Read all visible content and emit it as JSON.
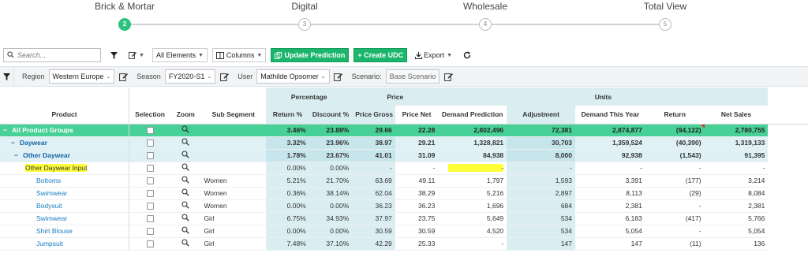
{
  "stepper": {
    "steps": [
      {
        "label": "Brick & Mortar",
        "number": "2",
        "active": true
      },
      {
        "label": "Digital",
        "number": "3",
        "active": false
      },
      {
        "label": "Wholesale",
        "number": "4",
        "active": false
      },
      {
        "label": "Total View",
        "number": "5",
        "active": false
      }
    ]
  },
  "toolbar": {
    "search_placeholder": "Search...",
    "all_elements": "All Elements",
    "columns": "Columns",
    "update_prediction": "Update Prediction",
    "create_udc": "+ Create UDC",
    "export": "Export"
  },
  "filters": {
    "region_label": "Region",
    "region_value": "Western Europe",
    "season_label": "Season",
    "season_value": "FY2020-S1",
    "user_label": "User",
    "user_value": "Mathilde Opsomer",
    "scenario_label": "Scenario:",
    "scenario_value": "Base Scenario"
  },
  "grid": {
    "groups": {
      "percentage": "Percentage",
      "price": "Price",
      "units": "Units"
    },
    "columns": {
      "product": "Product",
      "selection": "Selection",
      "zoom": "Zoom",
      "sub_segment": "Sub Segment",
      "return_pct": "Return %",
      "discount_pct": "Discount %",
      "price_gross": "Price Gross",
      "price_net": "Price Net",
      "demand_prediction": "Demand Prediction",
      "adjustment": "Adjustment",
      "demand_this_year": "Demand This Year",
      "return": "Return",
      "net_sales": "Net Sales"
    },
    "rows": [
      {
        "type": "group-top",
        "product": "All Product Groups",
        "sub": "",
        "return_pct": "3.46%",
        "discount_pct": "23.88%",
        "price_gross": "29.66",
        "price_net": "22.28",
        "demand_prediction": "2,802,496",
        "adjustment": "72,381",
        "demand_this_year": "2,874,877",
        "return": "(94,122)",
        "net_sales": "2,780,755"
      },
      {
        "type": "group",
        "product": "Daywear",
        "sub": "",
        "return_pct": "3.32%",
        "discount_pct": "23.96%",
        "price_gross": "38.97",
        "price_net": "29.21",
        "demand_prediction": "1,328,821",
        "adjustment": "30,703",
        "demand_this_year": "1,359,524",
        "return": "(40,390)",
        "net_sales": "1,319,133"
      },
      {
        "type": "group",
        "product": "Other Daywear",
        "sub": "",
        "return_pct": "1.78%",
        "discount_pct": "23.67%",
        "price_gross": "41.01",
        "price_net": "31.09",
        "demand_prediction": "84,938",
        "adjustment": "8,000",
        "demand_this_year": "92,938",
        "return": "(1,543)",
        "net_sales": "91,395"
      },
      {
        "type": "input",
        "product": "Other Daywear Input",
        "sub": "",
        "return_pct": "0.00%",
        "discount_pct": "0.00%",
        "price_gross": "-",
        "price_net": "-",
        "demand_prediction": "-",
        "adjustment": "-",
        "demand_this_year": "-",
        "return": "-",
        "net_sales": "-"
      },
      {
        "type": "leaf",
        "product": "Bottoms",
        "sub": "Women",
        "return_pct": "5.21%",
        "discount_pct": "21.70%",
        "price_gross": "63.69",
        "price_net": "49.11",
        "demand_prediction": "1,797",
        "adjustment": "1,593",
        "demand_this_year": "3,391",
        "return": "(177)",
        "net_sales": "3,214"
      },
      {
        "type": "leaf",
        "product": "Swimwear",
        "sub": "Women",
        "return_pct": "0.36%",
        "discount_pct": "38.14%",
        "price_gross": "62.04",
        "price_net": "38.29",
        "demand_prediction": "5,216",
        "adjustment": "2,897",
        "demand_this_year": "8,113",
        "return": "(29)",
        "net_sales": "8,084"
      },
      {
        "type": "leaf",
        "product": "Bodysuit",
        "sub": "Women",
        "return_pct": "0.00%",
        "discount_pct": "0.00%",
        "price_gross": "36.23",
        "price_net": "36.23",
        "demand_prediction": "1,696",
        "adjustment": "684",
        "demand_this_year": "2,381",
        "return": "-",
        "net_sales": "2,381"
      },
      {
        "type": "leaf",
        "product": "Swimwear",
        "sub": "Girl",
        "return_pct": "6.75%",
        "discount_pct": "34.93%",
        "price_gross": "37.97",
        "price_net": "23.75",
        "demand_prediction": "5,649",
        "adjustment": "534",
        "demand_this_year": "6,183",
        "return": "(417)",
        "net_sales": "5,766"
      },
      {
        "type": "leaf",
        "product": "Shirt Blouse",
        "sub": "Girl",
        "return_pct": "0.00%",
        "discount_pct": "0.00%",
        "price_gross": "30.59",
        "price_net": "30.59",
        "demand_prediction": "4,520",
        "adjustment": "534",
        "demand_this_year": "5,054",
        "return": "-",
        "net_sales": "5,054"
      },
      {
        "type": "leaf",
        "product": "Jumpsuit",
        "sub": "Girl",
        "return_pct": "7.48%",
        "discount_pct": "37.10%",
        "price_gross": "42.29",
        "price_net": "25.33",
        "demand_prediction": "-",
        "adjustment": "147",
        "demand_this_year": "147",
        "return": "(11)",
        "net_sales": "136"
      }
    ]
  }
}
